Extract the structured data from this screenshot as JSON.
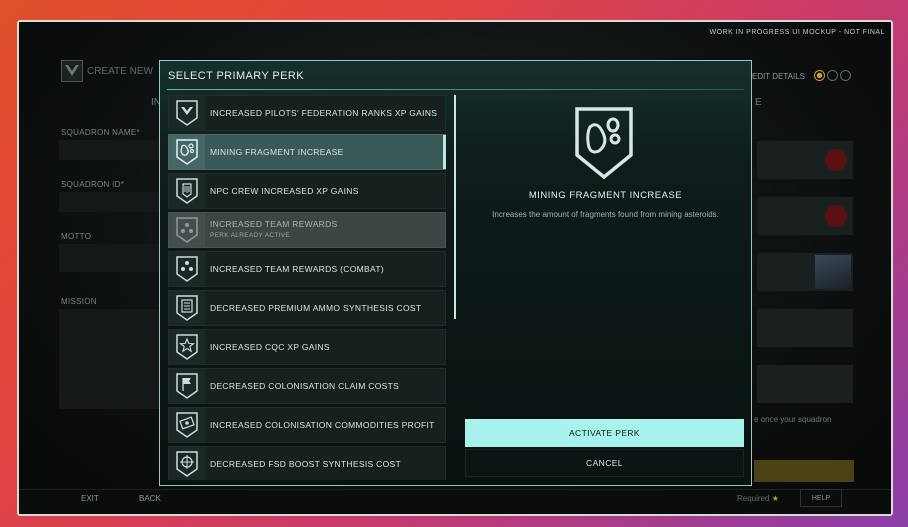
{
  "banner": "WORK IN PROGRESS UI MOCKUP - NOT FINAL",
  "background": {
    "create_label": "CREATE NEW",
    "edit_details": "EDIT DETAILS",
    "tab_left": "IN",
    "tab_right": "E",
    "fields": {
      "squadron_name": "SQUADRON NAME*",
      "squadron_id": "SQUADRON ID*",
      "motto": "MOTTO",
      "mission": "MISSION"
    },
    "once_text": "e once your squadron",
    "exit": "EXIT",
    "back": "BACK",
    "required": "Required",
    "required_star": "★",
    "help": "HELP"
  },
  "modal": {
    "title": "SELECT PRIMARY PERK",
    "perks": [
      {
        "label": "INCREASED PILOTS' FEDERATION RANKS XP GAINS",
        "icon": "federation-wings-icon"
      },
      {
        "label": "MINING FRAGMENT INCREASE",
        "icon": "mining-fragment-icon"
      },
      {
        "label": "NPC CREW INCREASED XP GAINS",
        "icon": "npc-crew-icon"
      },
      {
        "label": "INCREASED TEAM REWARDS",
        "sublabel": "PERK ALREADY ACTIVE",
        "icon": "team-rewards-icon"
      },
      {
        "label": "INCREASED TEAM REWARDS (COMBAT)",
        "icon": "team-rewards-combat-icon"
      },
      {
        "label": "DECREASED PREMIUM AMMO SYNTHESIS COST",
        "icon": "ammo-synthesis-icon"
      },
      {
        "label": "INCREASED CQC XP GAINS",
        "icon": "cqc-star-icon"
      },
      {
        "label": "DECREASED COLONISATION CLAIM COSTS",
        "icon": "colonisation-flag-icon"
      },
      {
        "label": "INCREASED COLONISATION COMMODITIES PROFIT",
        "icon": "commodities-profit-icon"
      },
      {
        "label": "DECREASED FSD BOOST SYNTHESIS COST",
        "icon": "fsd-boost-icon"
      }
    ],
    "selected_index": 1,
    "detail": {
      "title": "MINING FRAGMENT INCREASE",
      "description": "Increases the amount of fragments found from mining asteroids.",
      "icon": "mining-fragment-icon"
    },
    "activate_label": "ACTIVATE PERK",
    "cancel_label": "CANCEL"
  },
  "colors": {
    "accent": "#a8f2ee",
    "modal_border": "#9fc4c0",
    "selected_row": "#3a5856"
  }
}
